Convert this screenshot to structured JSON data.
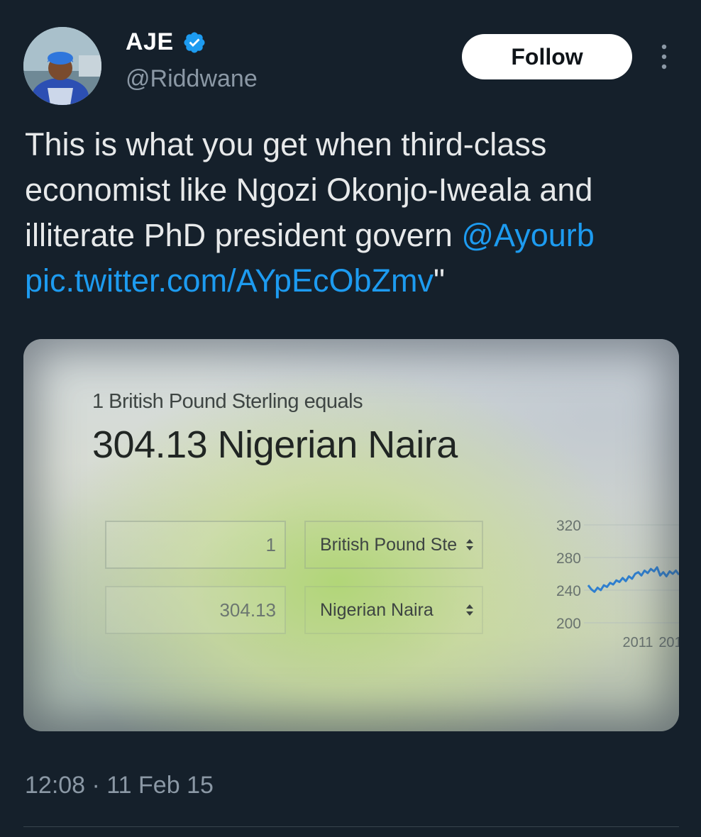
{
  "user": {
    "display_name": "AJE",
    "handle": "@Riddwane",
    "verified": true,
    "avatar_icon": "profile-photo"
  },
  "actions": {
    "follow_label": "Follow",
    "more_icon": "vertical-ellipsis-icon"
  },
  "tweet": {
    "text_lines": [
      "This is what you get when third-class",
      "economist like Ngozi Okonjo-Iweala and",
      "illiterate PhD president govern "
    ],
    "mention": "@Ayourb",
    "link": "pic.twitter.com/AYpEcObZmv",
    "trailing_quote": "\"",
    "timestamp": "12:08 · 11 Feb 15"
  },
  "media": {
    "intro": "1 British Pound Sterling equals",
    "result": "304.13 Nigerian Naira",
    "from_amount": "1",
    "from_currency": "British Pound Ste",
    "to_amount": "304.13",
    "to_currency": "Nigerian Naira"
  },
  "chart_data": {
    "type": "line",
    "y_ticks": [
      "320",
      "280",
      "240",
      "200"
    ],
    "ylim": [
      200,
      320
    ],
    "x_ticks": [
      "2011",
      "201"
    ],
    "series": [
      {
        "values": [
          246,
          241,
          238,
          243,
          240,
          246,
          244,
          249,
          247,
          252,
          250,
          255,
          251,
          257,
          254,
          260,
          262,
          258,
          264,
          261,
          266,
          263,
          268,
          258,
          262,
          257,
          263,
          260,
          264,
          259
        ]
      }
    ],
    "line_color": "#2f7fcf",
    "grid": true
  },
  "colors": {
    "background": "#15202b",
    "link": "#1d9bf0",
    "verified": "#1d9bf0",
    "muted": "#8b98a5"
  }
}
